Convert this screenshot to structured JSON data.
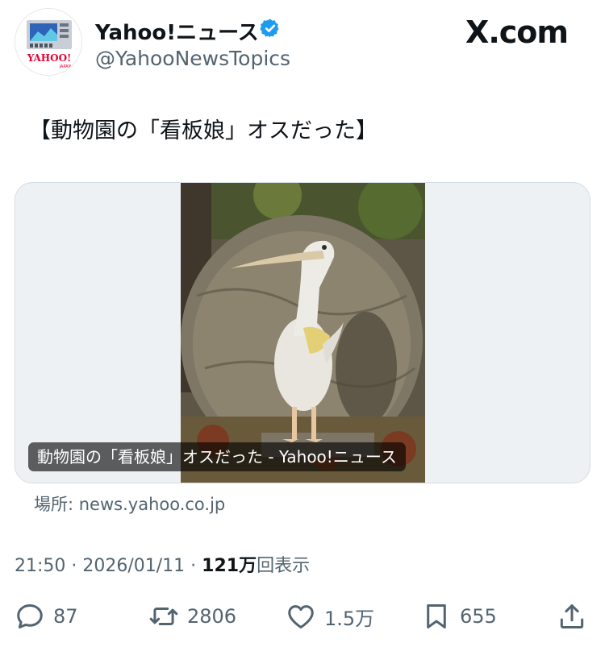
{
  "account": {
    "display_name": "Yahoo!ニュース",
    "handle": "@YahooNewsTopics",
    "avatar_text": "YAHOO!",
    "avatar_subtext": "JAPAN",
    "verified_color": "#1d9bf0"
  },
  "site_logo": "X.com",
  "tweet": {
    "text": "【動物園の「看板娘」オスだった】"
  },
  "link_card": {
    "caption": "動物園の「看板娘」オスだった - Yahoo!ニュース",
    "source_label": "場所: news.yahoo.co.jp"
  },
  "meta": {
    "time_date": "21:50 · 2026/01/11 · ",
    "views_count": "121万",
    "views_label": "回表示"
  },
  "actions": {
    "replies": "87",
    "reposts": "2806",
    "likes": "1.5万",
    "bookmarks": "655"
  }
}
